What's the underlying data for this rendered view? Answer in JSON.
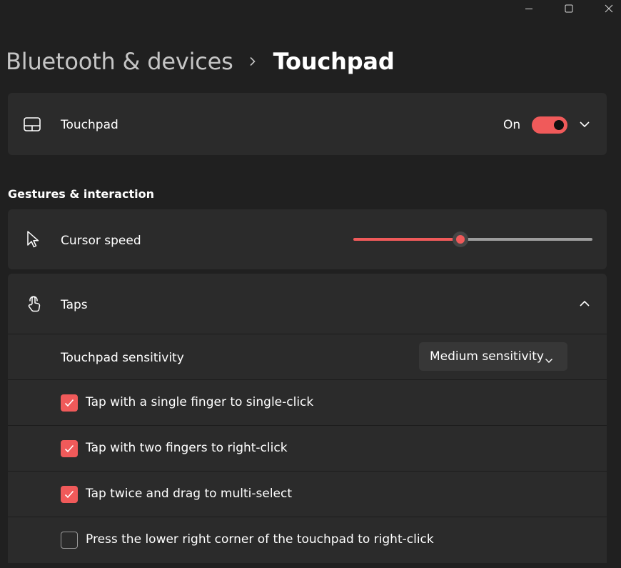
{
  "window": {
    "controls": {
      "minimize": "minimize-icon",
      "maximize": "maximize-icon",
      "close": "close-icon"
    }
  },
  "breadcrumb": {
    "parent": "Bluetooth & devices",
    "current": "Touchpad"
  },
  "touchpad_card": {
    "icon": "touchpad-icon",
    "label": "Touchpad",
    "state_text": "On",
    "toggle_on": true,
    "accent": "#f05a5a"
  },
  "gestures": {
    "section_title": "Gestures & interaction",
    "cursor_speed": {
      "label": "Cursor speed",
      "icon": "cursor-icon",
      "value_fraction": 0.45
    },
    "taps": {
      "label": "Taps",
      "icon": "tap-hand-icon",
      "expanded": true,
      "sensitivity": {
        "label": "Touchpad sensitivity",
        "selected": "Medium sensitivity"
      },
      "options": [
        {
          "label": "Tap with a single finger to single-click",
          "checked": true
        },
        {
          "label": "Tap with two fingers to right-click",
          "checked": true
        },
        {
          "label": "Tap twice and drag to multi-select",
          "checked": true
        },
        {
          "label": "Press the lower right corner of the touchpad to right-click",
          "checked": false
        }
      ]
    }
  }
}
